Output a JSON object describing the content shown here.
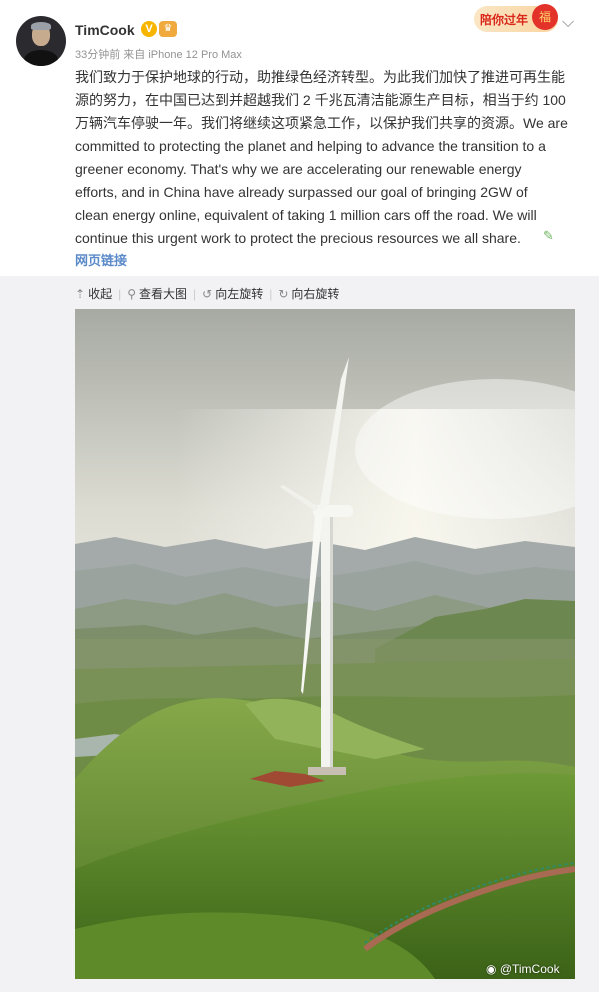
{
  "post": {
    "author": "TimCook",
    "meta": "33分钟前 来自 iPhone 12 Pro Max",
    "badge_text": "陪你过年",
    "text_lines": [
      "我们致力于保护地球的行动，助推绿色经济转型。为此我们加快了推进可再生能",
      "源的努力，在中国已达到并超越我们 2 千兆瓦清洁能源生产目标，相当于约 100",
      "万辆汽车停驶一年。我们将继续这项紧急工作，以保护我们共享的资源。We are",
      "committed to protecting the planet and helping to advance the transition to a",
      "greener economy. That's why we are accelerating our renewable energy",
      "efforts, and in China have already surpassed our goal of bringing 2GW of",
      "clean energy online, equivalent of taking 1 million cars off the road. We will",
      "continue this urgent work to protect the precious resources we all share."
    ],
    "link_label": "网页链接"
  },
  "image_actions": {
    "collapse": "收起",
    "view_large": "查看大图",
    "rotate_left": "向左旋转",
    "rotate_right": "向右旋转"
  },
  "watermark": "@TimCook",
  "colors": {
    "link": "#5b8ac9",
    "meta": "#939393",
    "verified": "#f7b500",
    "badge_text": "#d9281a",
    "page_bg": "#f2f2f5"
  },
  "icons": [
    "verified-icon",
    "member-icon",
    "lantern-icon",
    "chevron-down-icon",
    "edit-icon",
    "collapse-icon",
    "search-icon",
    "rotate-left-icon",
    "rotate-right-icon",
    "weibo-icon"
  ]
}
